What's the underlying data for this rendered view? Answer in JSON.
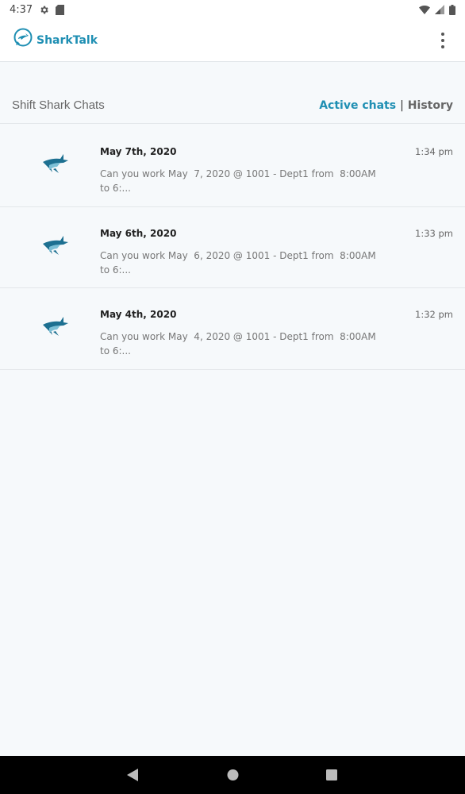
{
  "status_bar": {
    "time": "4:37"
  },
  "app": {
    "name": "SharkTalk"
  },
  "header": {
    "title": "Shift Shark Chats",
    "tab_active": "Active chats",
    "separator": "|",
    "tab_history": "History"
  },
  "chats": [
    {
      "date": "May 7th, 2020",
      "time": "1:34 pm",
      "preview": "Can you work May  7, 2020 @ 1001 - Dept1 from  8:00AM to 6:..."
    },
    {
      "date": "May 6th, 2020",
      "time": "1:33 pm",
      "preview": "Can you work May  6, 2020 @ 1001 - Dept1 from  8:00AM to 6:..."
    },
    {
      "date": "May 4th, 2020",
      "time": "1:32 pm",
      "preview": "Can you work May  4, 2020 @ 1001 - Dept1 from  8:00AM to 6:..."
    }
  ],
  "colors": {
    "brand": "#1f8fb3",
    "background": "#f6f9fb"
  },
  "icons": [
    "settings-icon",
    "sd-card-icon",
    "wifi-icon",
    "signal-icon",
    "battery-icon",
    "shark-logo-icon",
    "more-vert-icon",
    "shark-avatar-icon",
    "nav-back-icon",
    "nav-home-icon",
    "nav-recents-icon"
  ]
}
